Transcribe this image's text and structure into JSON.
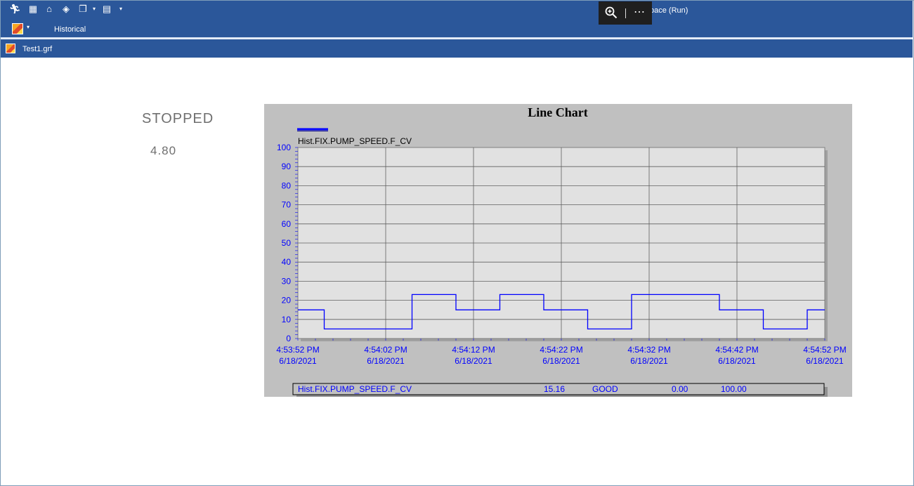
{
  "window": {
    "title_fragment": "pace (Run)"
  },
  "quick_access": {
    "icons": [
      "run-icon",
      "config-icon",
      "home-icon",
      "zoom-fit-icon",
      "window-icon",
      "grid-icon"
    ]
  },
  "toolbar": {
    "historical_label": "Historical"
  },
  "document": {
    "tab_label": "Test1.grf"
  },
  "left_panel": {
    "status": "STOPPED",
    "value": "4.80"
  },
  "colors": {
    "ribbon": "#2b579a",
    "chart_bg": "#c0c0c0",
    "plot_bg": "#e1e1e1",
    "series": "#0000ff"
  },
  "legend": {
    "tag": "Hist.FIX.PUMP_SPEED.F_CV",
    "value": "15.16",
    "quality": "GOOD",
    "low": "0.00",
    "high": "100.00"
  },
  "chart_data": {
    "type": "line",
    "title": "Line Chart",
    "ylim": [
      0,
      100
    ],
    "yticks": [
      "100",
      "90",
      "80",
      "70",
      "60",
      "50",
      "40",
      "30",
      "20",
      "10",
      "0"
    ],
    "xticks": [
      {
        "time": "4:53:52 PM",
        "date": "6/18/2021"
      },
      {
        "time": "4:54:02 PM",
        "date": "6/18/2021"
      },
      {
        "time": "4:54:12 PM",
        "date": "6/18/2021"
      },
      {
        "time": "4:54:22 PM",
        "date": "6/18/2021"
      },
      {
        "time": "4:54:32 PM",
        "date": "6/18/2021"
      },
      {
        "time": "4:54:42 PM",
        "date": "6/18/2021"
      },
      {
        "time": "4:54:52 PM",
        "date": "6/18/2021"
      }
    ],
    "grid": true,
    "series": [
      {
        "name": "Hist.FIX.PUMP_SPEED.F_CV",
        "points": [
          [
            "4:53:52 PM",
            15
          ],
          [
            "4:53:55 PM",
            15
          ],
          [
            "4:53:55 PM",
            5
          ],
          [
            "4:54:05 PM",
            5
          ],
          [
            "4:54:05 PM",
            23
          ],
          [
            "4:54:10 PM",
            23
          ],
          [
            "4:54:10 PM",
            15
          ],
          [
            "4:54:15 PM",
            15
          ],
          [
            "4:54:15 PM",
            23
          ],
          [
            "4:54:20 PM",
            23
          ],
          [
            "4:54:20 PM",
            15
          ],
          [
            "4:54:25 PM",
            15
          ],
          [
            "4:54:25 PM",
            5
          ],
          [
            "4:54:30 PM",
            5
          ],
          [
            "4:54:30 PM",
            23
          ],
          [
            "4:54:40 PM",
            23
          ],
          [
            "4:54:40 PM",
            15
          ],
          [
            "4:54:45 PM",
            15
          ],
          [
            "4:54:45 PM",
            5
          ],
          [
            "4:54:50 PM",
            5
          ],
          [
            "4:54:50 PM",
            15
          ],
          [
            "4:54:52 PM",
            15
          ]
        ]
      }
    ]
  }
}
